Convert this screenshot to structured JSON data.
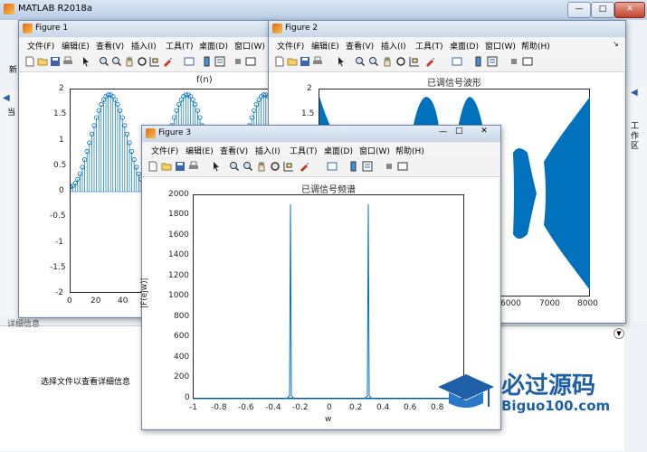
{
  "main_window": {
    "title": "MATLAB R2018a",
    "left_labels": [
      "新",
      "当",
      "详"
    ],
    "right_panel_label": "工作区",
    "detail_panel": {
      "title": "详细信息",
      "message": "选择文件以查看详细信息"
    }
  },
  "figure_menu": [
    "文件(F)",
    "编辑(E)",
    "查看(V)",
    "插入(I)",
    "工具(T)",
    "桌面(D)",
    "窗口(W)",
    "帮助(H)"
  ],
  "figure1": {
    "title": "Figure 1",
    "plot_title": "f(n)",
    "yticks": [
      "2",
      "1.5",
      "1",
      "0.5",
      "0",
      "-0.5",
      "-1",
      "-1.5",
      "-2"
    ],
    "xticks": [
      "0",
      "20",
      "40"
    ]
  },
  "figure2": {
    "title": "Figure 2",
    "plot_title": "已调信号波形",
    "yticks": [
      "2",
      "1.5"
    ],
    "xticks": [
      "6000",
      "7000",
      "8000"
    ]
  },
  "figure3": {
    "title": "Figure 3",
    "plot_title": "已调信号频谱",
    "ylabel": "|F(ejw)|",
    "xlabel": "w",
    "yticks": [
      "2000",
      "1800",
      "1600",
      "1400",
      "1200",
      "1000",
      "800",
      "600",
      "400",
      "200",
      "0"
    ],
    "xticks": [
      "-1",
      "-0.8",
      "-0.6",
      "-0.4",
      "-0.2",
      "0",
      "0.2",
      "0.4",
      "0.6",
      "0.8"
    ]
  },
  "watermark": {
    "text": "必过源码",
    "url": "Biguo100.com"
  },
  "colors": {
    "plot_blue": "#0072bd",
    "titlebar": "#c9d7e8"
  }
}
